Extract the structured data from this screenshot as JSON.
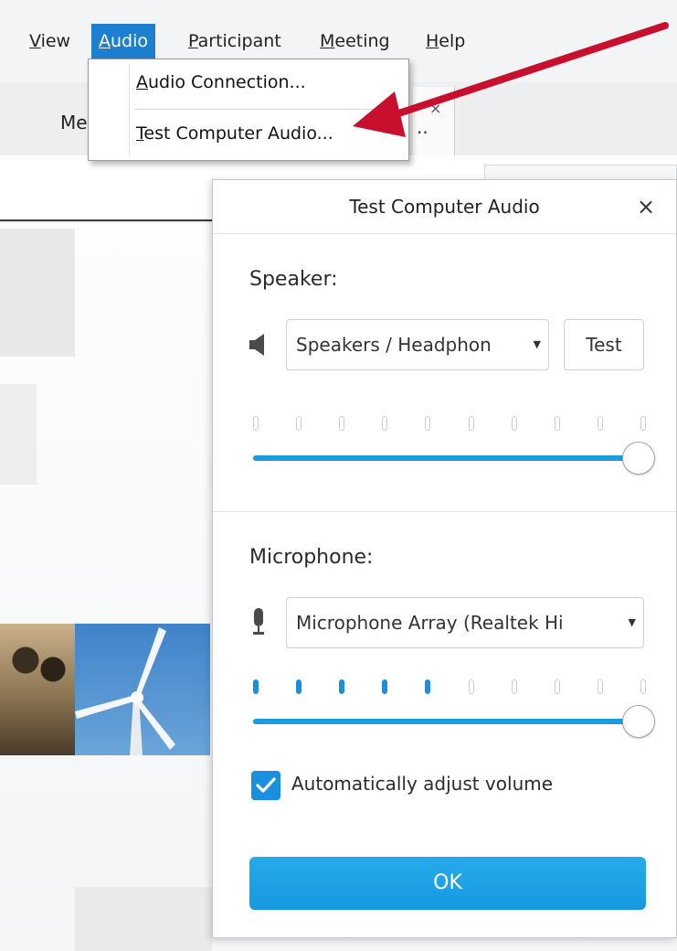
{
  "menubar": {
    "items": [
      {
        "pre": "",
        "mn": "V",
        "post": "iew"
      },
      {
        "pre": "",
        "mn": "A",
        "post": "udio"
      },
      {
        "pre": "",
        "mn": "P",
        "post": "articipant"
      },
      {
        "pre": "",
        "mn": "M",
        "post": "eeting"
      },
      {
        "pre": "",
        "mn": "H",
        "post": "elp"
      }
    ]
  },
  "tabs": {
    "partial_label": "Me",
    "fragment_dots": "..",
    "fragment_close": "×"
  },
  "audio_menu": {
    "items": [
      {
        "mn": "A",
        "post": "udio Connection..."
      },
      {
        "mn": "T",
        "post": "est Computer Audio..."
      }
    ]
  },
  "dialog": {
    "title": "Test Computer Audio",
    "close_glyph": "×",
    "speaker": {
      "label": "Speaker:",
      "device": "Speakers / Headphon",
      "test_label": "Test",
      "meter_active": 0,
      "meter_total": 10,
      "volume": 1.0
    },
    "microphone": {
      "label": "Microphone:",
      "device": "Microphone Array (Realtek Hi",
      "meter_active": 5,
      "meter_total": 10,
      "volume": 1.0
    },
    "auto_adjust": {
      "label": "Automatically adjust volume",
      "checked": true
    },
    "ok_label": "OK"
  },
  "colors": {
    "accent": "#1a9ae0",
    "menu_highlight": "#1d7fd0",
    "arrow": "#c8102e"
  },
  "icons": {
    "speaker": "speaker-icon",
    "microphone": "microphone-icon",
    "close": "close-icon",
    "checkmark": "checkmark-icon"
  }
}
